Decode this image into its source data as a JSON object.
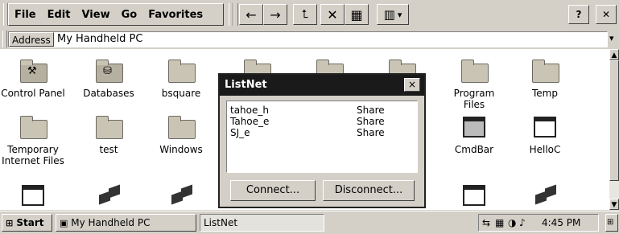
{
  "menu": [
    {
      "label": "File"
    },
    {
      "label": "Edit"
    },
    {
      "label": "View"
    },
    {
      "label": "Go"
    },
    {
      "label": "Favorites"
    }
  ],
  "toolbar": {
    "back_icon": "←",
    "forward_icon": "→",
    "up_icon": "⮤",
    "delete_icon": "✕",
    "properties_icon": "▦",
    "views_icon": "▥",
    "views_dropdown_icon": "▾",
    "help_label": "?",
    "close_label": "✕"
  },
  "address": {
    "label": "Address",
    "value": "My Handheld PC",
    "dropdown_icon": "▾"
  },
  "items": [
    {
      "label": "Control Panel",
      "icon": "control-panel-icon"
    },
    {
      "label": "Databases",
      "icon": "databases-icon"
    },
    {
      "label": "bsquare",
      "icon": "folder-icon"
    },
    {
      "label": "",
      "icon": "folder-icon"
    },
    {
      "label": "",
      "icon": "folder-icon"
    },
    {
      "label": "",
      "icon": "folder-icon"
    },
    {
      "label": "Program Files",
      "icon": "folder-icon"
    },
    {
      "label": "Temp",
      "icon": "folder-icon"
    },
    {
      "label": "Temporary Internet Files",
      "icon": "folder-icon"
    },
    {
      "label": "test",
      "icon": "folder-icon"
    },
    {
      "label": "Windows",
      "icon": "folder-icon"
    },
    {
      "label": "CmdBar",
      "icon": "application-icon"
    },
    {
      "label": "HelloC",
      "icon": "application-icon"
    }
  ],
  "dialog": {
    "title": "ListNet",
    "close_label": "×",
    "rows": [
      {
        "name": "tahoe_h",
        "type": "Share"
      },
      {
        "name": "Tahoe_e",
        "type": "Share"
      },
      {
        "name": "SJ_e",
        "type": "Share"
      }
    ],
    "connect_label": "Connect...",
    "disconnect_label": "Disconnect..."
  },
  "taskbar": {
    "start_label": "Start",
    "tasks": [
      {
        "label": "My Handheld PC"
      },
      {
        "label": "ListNet"
      }
    ],
    "time": "4:45 PM"
  },
  "scrollbar": {
    "up_icon": "▲",
    "down_icon": "▼"
  }
}
